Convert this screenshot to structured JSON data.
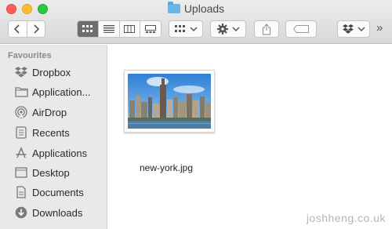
{
  "window": {
    "title": "Uploads"
  },
  "toolbar": {
    "more_label": "»"
  },
  "sidebar": {
    "section_title": "Favourites",
    "items": [
      {
        "label": "Dropbox",
        "icon": "dropbox-icon"
      },
      {
        "label": "Application...",
        "icon": "folder-icon"
      },
      {
        "label": "AirDrop",
        "icon": "airdrop-icon"
      },
      {
        "label": "Recents",
        "icon": "recents-icon"
      },
      {
        "label": "Applications",
        "icon": "applications-icon"
      },
      {
        "label": "Desktop",
        "icon": "desktop-icon"
      },
      {
        "label": "Documents",
        "icon": "documents-icon"
      },
      {
        "label": "Downloads",
        "icon": "downloads-icon"
      }
    ]
  },
  "files": [
    {
      "name": "new-york.jpg"
    }
  ],
  "watermark": "joshheng.co.uk",
  "colors": {
    "close": "#fc5f57",
    "minimize": "#fdbc2e",
    "maximize": "#28c840",
    "folder_blue": "#6cb4e8",
    "sidebar_bg": "#e9e9e9"
  }
}
